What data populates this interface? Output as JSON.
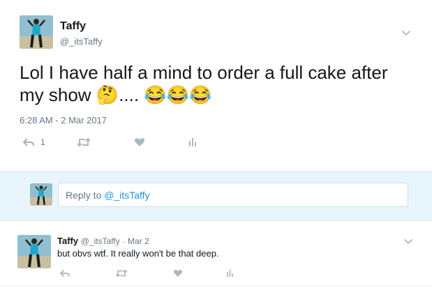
{
  "main_tweet": {
    "display_name": "Taffy",
    "handle": "@_itsTaffy",
    "text": "Lol I have half a mind to order a full cake after my show",
    "emoji_after_show": "🤔",
    "ellipsis": "....",
    "emoji_end": "😂😂😂",
    "timestamp": "6:28 AM - 2 Mar 2017",
    "reply_count": "1"
  },
  "reply_composer": {
    "prefix": "Reply to ",
    "handle": "@_itsTaffy"
  },
  "reply_tweet": {
    "display_name": "Taffy",
    "handle": "@_itsTaffy",
    "separator": "·",
    "date": "Mar 2",
    "text": "but obvs wtf. It really won't be that deep."
  },
  "icons": {
    "menu": "chevron-down-icon",
    "reply": "reply-icon",
    "retweet": "retweet-icon",
    "like": "heart-icon",
    "analytics": "analytics-icon"
  },
  "colors": {
    "text": "#14171a",
    "muted": "#657786",
    "action_icon": "#aab8c2",
    "link": "#1b95e0",
    "reply_band": "#e8f5fd"
  }
}
